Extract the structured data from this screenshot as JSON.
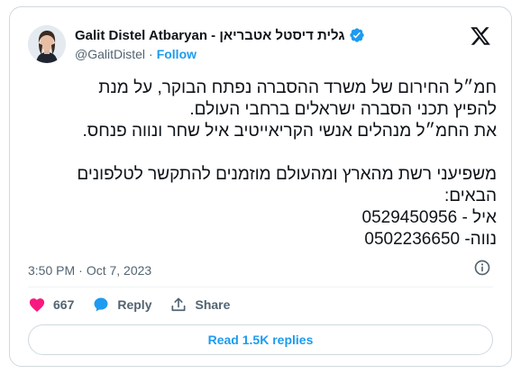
{
  "author": {
    "display_name": "Galit Distel Atbaryan - גלית דיסטל אטבריאן",
    "handle": "@GalitDistel",
    "separator": "·",
    "follow_label": "Follow",
    "verified": true
  },
  "tweet": {
    "lines": [
      "חמ״ל החירום של משרד ההסברה נפתח הבוקר, על מנת",
      "להפיץ תכני הסברה ישראלים ברחבי העולם.",
      "את החמ״ל מנהלים אנשי הקריאייטיב איל שחר ונווה פנחס.",
      "",
      "משפיעני רשת מהארץ ומהעולם מוזמנים להתקשר לטלפונים",
      "הבאים:",
      "איל - 0529450956",
      "נווה- 0502236650"
    ]
  },
  "meta": {
    "time": "3:50 PM",
    "separator": "·",
    "date": "Oct 7, 2023"
  },
  "actions": {
    "likes_count": "667",
    "reply_label": "Reply",
    "share_label": "Share"
  },
  "read_replies_label": "Read 1.5K replies",
  "colors": {
    "accent": "#1d9bf0",
    "like": "#f91880",
    "secondary_text": "#536471",
    "border": "#cfd9de"
  },
  "icons": {
    "brand": "x-logo-icon",
    "verified": "verified-badge-icon",
    "like": "heart-icon",
    "reply": "reply-bubble-icon",
    "share": "share-icon",
    "info": "info-icon"
  }
}
